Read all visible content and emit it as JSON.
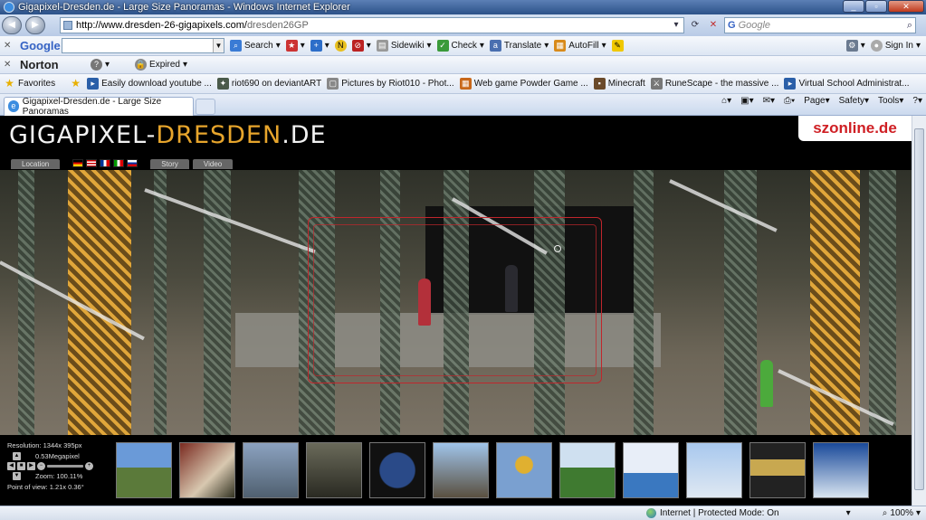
{
  "window": {
    "title": "Gigapixel-Dresden.de - Large Size Panoramas - Windows Internet Explorer"
  },
  "address": {
    "url_domain": "http://www.dresden-26-gigapixels.com/",
    "url_path": "dresden26GP",
    "search_placeholder": "Google"
  },
  "google_toolbar": {
    "logo": "Google",
    "items": [
      "Search",
      "Sidewiki",
      "Check",
      "Translate",
      "AutoFill",
      "Sign In"
    ]
  },
  "norton_toolbar": {
    "logo": "Norton",
    "status": "Expired"
  },
  "favorites": {
    "label": "Favorites",
    "items": [
      "Easily download youtube ...",
      "riot690 on deviantART",
      "Pictures by Riot010 - Phot...",
      "Web game Powder Game ...",
      "Minecraft",
      "RuneScape - the massive ...",
      "Virtual School Administrat..."
    ]
  },
  "tab": {
    "label": "Gigapixel-Dresden.de - Large Size Panoramas"
  },
  "command_bar": {
    "page": "Page",
    "safety": "Safety",
    "tools": "Tools"
  },
  "site": {
    "title_a": "GIGAPIXEL-",
    "title_b": "DRESDEN",
    "title_c": ".DE",
    "partner": "szonline.de",
    "tabs": [
      "Location",
      "Story",
      "Video"
    ],
    "info": {
      "resolution": "Resolution: 1344x 395px",
      "megapixel": "0.53Megapixel",
      "zoom": "Zoom: 100.11%",
      "point_of_view": "Point of view: 1.21x 0.36°"
    }
  },
  "status": {
    "zone": "Internet | Protected Mode: On",
    "zoom": "100%"
  }
}
